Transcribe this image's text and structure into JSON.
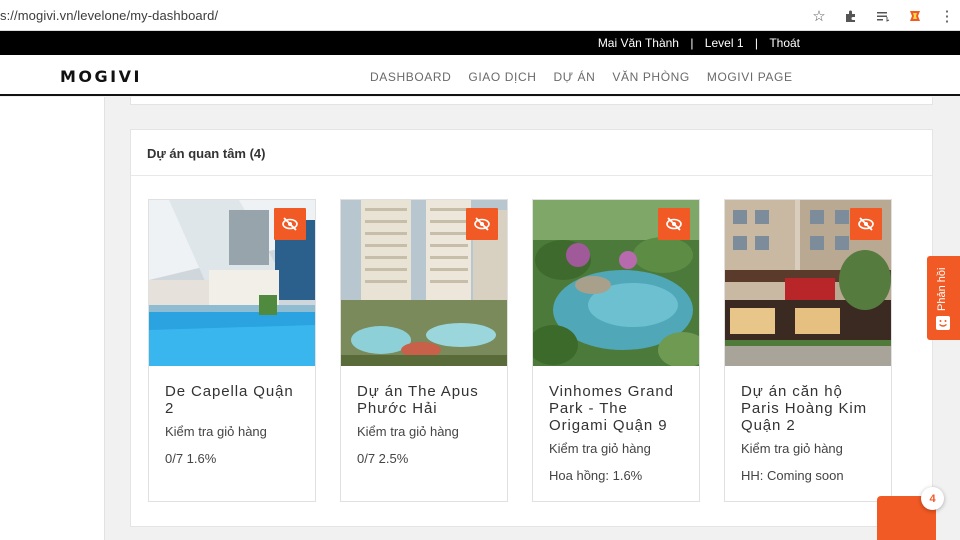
{
  "browser": {
    "url": "s://mogivi.vn/levelone/my-dashboard/"
  },
  "user_bar": {
    "name": "Mai Văn Thành",
    "level": "Level 1",
    "logout": "Thoát",
    "separator": "|"
  },
  "brand": {
    "logo": "MOGIVI"
  },
  "nav": {
    "items": [
      "DASHBOARD",
      "GIAO DỊCH",
      "DỰ ÁN",
      "VĂN PHÒNG",
      "MOGIVI PAGE"
    ]
  },
  "panel": {
    "title": "Dự án quan tâm (4)"
  },
  "projects": [
    {
      "title": "De Capella Quận 2",
      "check": "Kiểm tra giỏ hàng",
      "value": "0/7 1.6%",
      "icon": "eye-slash-icon"
    },
    {
      "title": "Dự án The Apus Phước Hải",
      "check": "Kiểm tra giỏ hàng",
      "value": "0/7 2.5%",
      "icon": "eye-slash-icon"
    },
    {
      "title": "Vinhomes Grand Park - The Origami Quận 9",
      "check": "Kiểm tra giỏ hàng",
      "value": "Hoa hồng: 1.6%",
      "icon": "eye-slash-icon"
    },
    {
      "title": "Dự án căn hộ Paris Hoàng Kim Quận 2",
      "check": "Kiểm tra giỏ hàng",
      "value": "HH: Coming soon",
      "icon": "eye-slash-icon"
    }
  ],
  "feedback": {
    "label": "Phản hồi"
  },
  "chat": {
    "badge": "4"
  },
  "colors": {
    "accent": "#f15a24",
    "topbar": "#000000"
  }
}
